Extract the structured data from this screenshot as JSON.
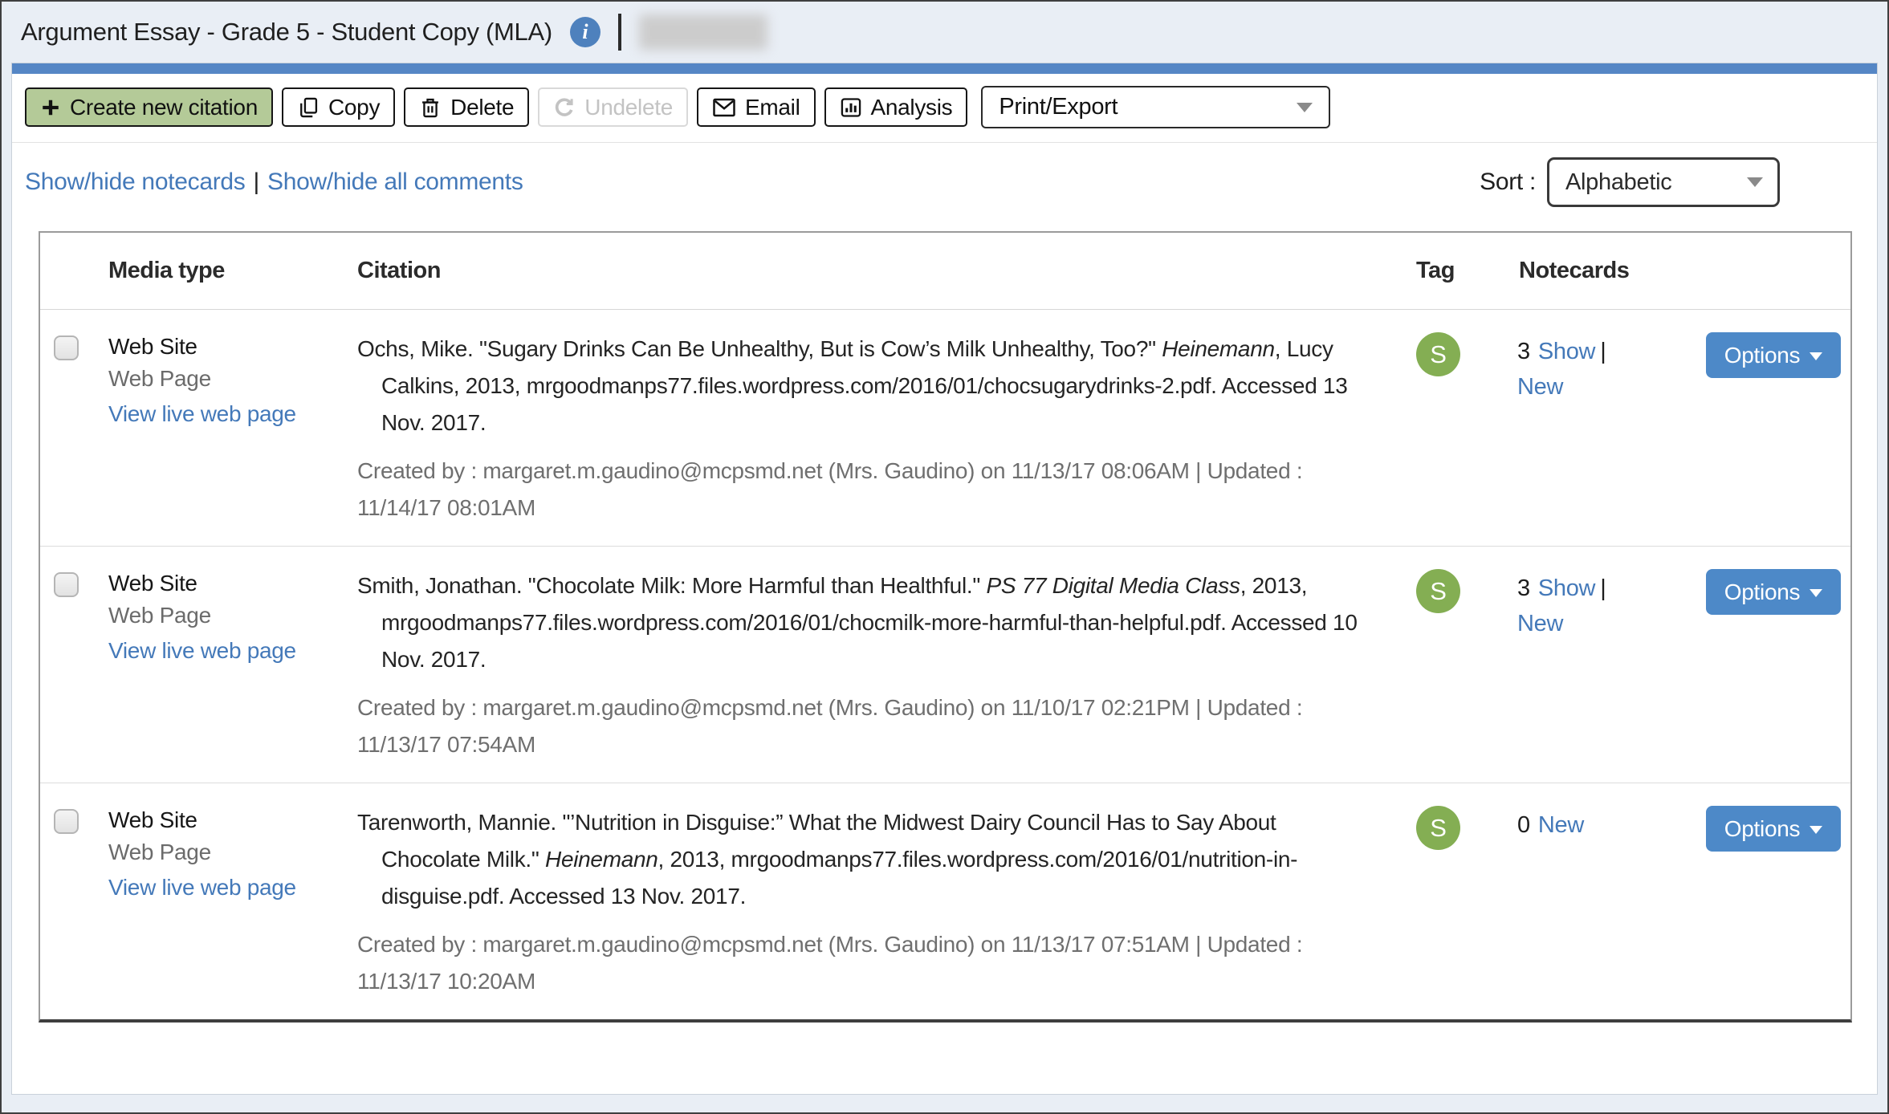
{
  "header": {
    "title": "Argument Essay - Grade 5 - Student Copy  (MLA)",
    "info_glyph": "i"
  },
  "toolbar": {
    "create_label": "Create new citation",
    "copy_label": "Copy",
    "delete_label": "Delete",
    "undelete_label": "Undelete",
    "email_label": "Email",
    "analysis_label": "Analysis",
    "print_export_label": "Print/Export"
  },
  "subbar": {
    "show_hide_notecards": "Show/hide notecards",
    "separator": "|",
    "show_hide_comments": "Show/hide all comments",
    "sort_label": "Sort :",
    "sort_value": "Alphabetic"
  },
  "table": {
    "headers": {
      "media_type": "Media type",
      "citation": "Citation",
      "tag": "Tag",
      "notecards": "Notecards"
    },
    "options_label": "Options",
    "rows": [
      {
        "media_type": "Web Site",
        "media_subtype": "Web Page",
        "view_link": "View live web page",
        "citation": [
          {
            "text": "Ochs, Mike. \"Sugary Drinks Can Be Unhealthy, But is Cow’s Milk Unhealthy, Too?\" "
          },
          {
            "text": "Heinemann",
            "italic": true
          },
          {
            "text": ", Lucy Calkins, 2013, mrgoodmanps77.files.wordpress.com/2016/01/chocsugarydrinks-2.pdf. Accessed 13 Nov. 2017."
          }
        ],
        "meta": "Created by : margaret.m.gaudino@mcpsmd.net (Mrs. Gaudino) on 11/13/17 08:06AM | Updated : 11/14/17 08:01AM",
        "tag": "S",
        "notecards": {
          "count": "3",
          "show_label": "Show",
          "separator": "|",
          "new_label": "New"
        }
      },
      {
        "media_type": "Web Site",
        "media_subtype": "Web Page",
        "view_link": "View live web page",
        "citation": [
          {
            "text": "Smith, Jonathan. \"Chocolate Milk: More Harmful than Healthful.\" "
          },
          {
            "text": "PS 77 Digital Media Class",
            "italic": true
          },
          {
            "text": ", 2013, mrgoodmanps77.files.wordpress.com/2016/01/chocmilk-more-harmful-than-helpful.pdf. Accessed 10 Nov. 2017."
          }
        ],
        "meta": "Created by : margaret.m.gaudino@mcpsmd.net (Mrs. Gaudino) on 11/10/17 02:21PM | Updated : 11/13/17 07:54AM",
        "tag": "S",
        "notecards": {
          "count": "3",
          "show_label": "Show",
          "separator": "|",
          "new_label": "New"
        }
      },
      {
        "media_type": "Web Site",
        "media_subtype": "Web Page",
        "view_link": "View live web page",
        "citation": [
          {
            "text": "Tarenworth, Mannie. \"’Nutrition in Disguise:” What the Midwest Dairy Council Has to Say About Chocolate Milk.\" "
          },
          {
            "text": "Heinemann",
            "italic": true
          },
          {
            "text": ", 2013, mrgoodmanps77.files.wordpress.com/2016/01/nutrition-in-disguise.pdf. Accessed 13 Nov. 2017."
          }
        ],
        "meta": "Created by : margaret.m.gaudino@mcpsmd.net (Mrs. Gaudino) on 11/13/17 07:51AM | Updated : 11/13/17 10:20AM",
        "tag": "S",
        "notecards": {
          "count": "0",
          "new_label": "New"
        }
      }
    ]
  },
  "colors": {
    "top_bar_blue": "#5586c5",
    "create_button_green": "#b4ca98",
    "link_blue": "#4479b9",
    "options_blue": "#4d89c8",
    "tag_green": "#84ae53",
    "page_background": "#e9eef5"
  }
}
